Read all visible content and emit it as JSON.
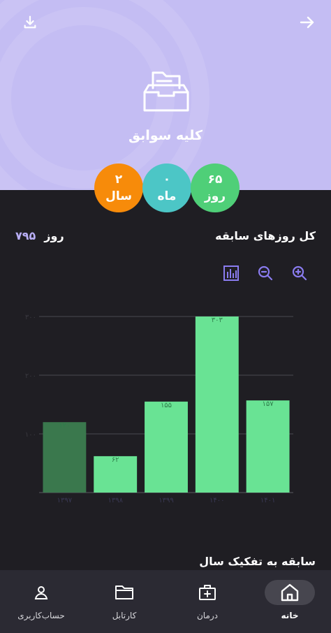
{
  "header": {
    "title": "کلیه سوابق",
    "download_icon": "download-icon",
    "back_icon": "arrow-right-icon",
    "folder_icon": "folder-archive-icon",
    "background_color": "#c4bdf3"
  },
  "stats": {
    "days": {
      "value": "۶۵",
      "unit": "روز",
      "color": "#4fcf78"
    },
    "months": {
      "value": "۰",
      "unit": "ماه",
      "color": "#4cc6c6"
    },
    "years": {
      "value": "۲",
      "unit": "سال",
      "color": "#f78b0a"
    }
  },
  "summary": {
    "title": "کل روزهای سابقه",
    "value": "۷۹۵",
    "unit": "روز"
  },
  "toolbar": {
    "chart_icon": "bar-chart-icon",
    "zoom_out_icon": "zoom-out-icon",
    "zoom_in_icon": "zoom-in-icon",
    "accent_color": "#8a7cf0"
  },
  "chart_data": {
    "type": "bar",
    "categories": [
      "۱۳۹۷",
      "۱۳۹۸",
      "۱۳۹۹",
      "۱۴۰۰",
      "۱۴۰۱"
    ],
    "values": [
      120,
      62,
      155,
      303,
      157
    ],
    "value_labels": [
      "۱۲۰",
      "۶۲",
      "۱۵۵",
      "۳۰۳",
      "۱۵۷"
    ],
    "ylim": [
      0,
      300
    ],
    "y_ticks": [
      0,
      100,
      200,
      300
    ],
    "y_tick_labels": [
      "",
      "۱۰۰",
      "۲۰۰",
      "۳۰۰"
    ],
    "grid": true,
    "bar_color": "#69e394",
    "highlight_index": 0,
    "highlight_color": "#3a784d",
    "title": "",
    "xlabel": "",
    "ylabel": ""
  },
  "section": {
    "title": "سابقه به تفکیک سال"
  },
  "nav": {
    "items": [
      {
        "label": "حساب‌کاربری",
        "icon": "user-icon"
      },
      {
        "label": "کارتابل",
        "icon": "folder-icon"
      },
      {
        "label": "درمان",
        "icon": "medical-kit-icon"
      },
      {
        "label": "خانه",
        "icon": "home-icon",
        "active": true
      }
    ]
  }
}
